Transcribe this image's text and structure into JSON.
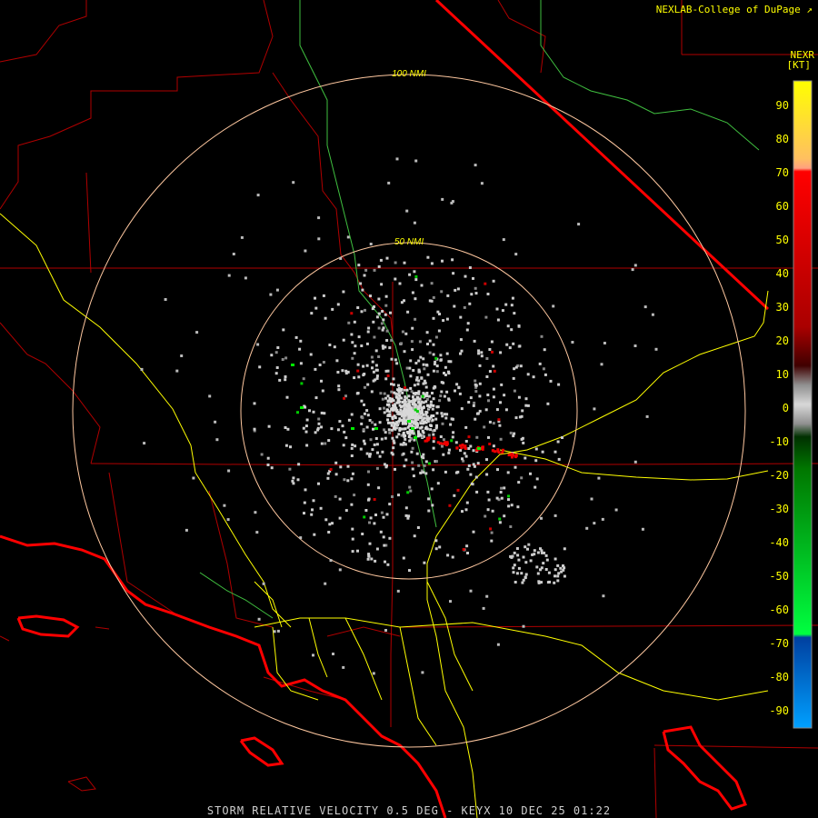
{
  "header": {
    "credit": "NEXLAB-College of DuPage",
    "credit_icon": "cursor-arrow-icon",
    "product": "NEXR",
    "unit": "[KT]"
  },
  "rings": [
    {
      "label": "100 NMI"
    },
    {
      "label": "50 NMI"
    }
  ],
  "legend": {
    "ticks": [
      "90",
      "80",
      "70",
      "60",
      "50",
      "40",
      "30",
      "20",
      "10",
      "0",
      "-10",
      "-20",
      "-30",
      "-40",
      "-50",
      "-60",
      "-70",
      "-80",
      "-90"
    ],
    "colors": {
      "high_yellow": "#ffff00",
      "orange": "#ffa040",
      "red": "#ff0000",
      "dark_red": "#550000",
      "gray": "#c8c8c8",
      "dark_green": "#005500",
      "green": "#00ff00",
      "blue": "#0050c0",
      "light_blue": "#00a0ff"
    }
  },
  "map_colors": {
    "state_border": "#ff0000",
    "county_border": "#b00000",
    "coastline": "#ff0000",
    "highway": "#ffff00",
    "river": "#40c040",
    "range_ring": "#ffc8a0"
  },
  "footer": {
    "caption": "STORM RELATIVE VELOCITY 0.5 DEG - KEYX 10 DEC 25 01:22"
  }
}
